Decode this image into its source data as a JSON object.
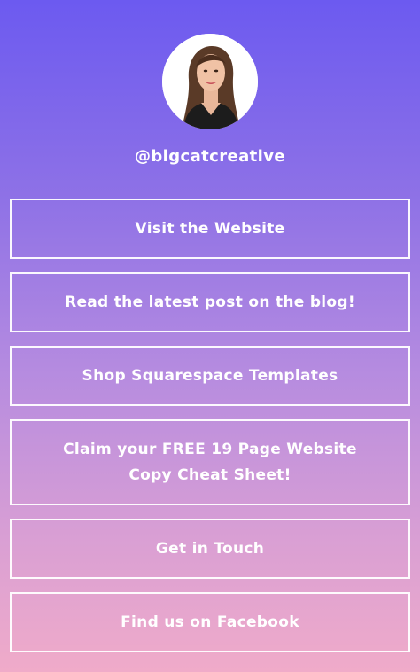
{
  "profile": {
    "handle": "@bigcatcreative",
    "avatar_icon": "profile-photo"
  },
  "links": [
    {
      "label": "Visit the Website"
    },
    {
      "label": "Read the latest post on the blog!"
    },
    {
      "label": "Shop Squarespace Templates"
    },
    {
      "label": "Claim your FREE 19 Page Website Copy Cheat Sheet!"
    },
    {
      "label": "Get in Touch"
    },
    {
      "label": "Find us on Facebook"
    }
  ],
  "colors": {
    "gradient_top": "#6c5af0",
    "gradient_bottom": "#f0abc9",
    "border": "#ffffff",
    "text": "#ffffff"
  }
}
